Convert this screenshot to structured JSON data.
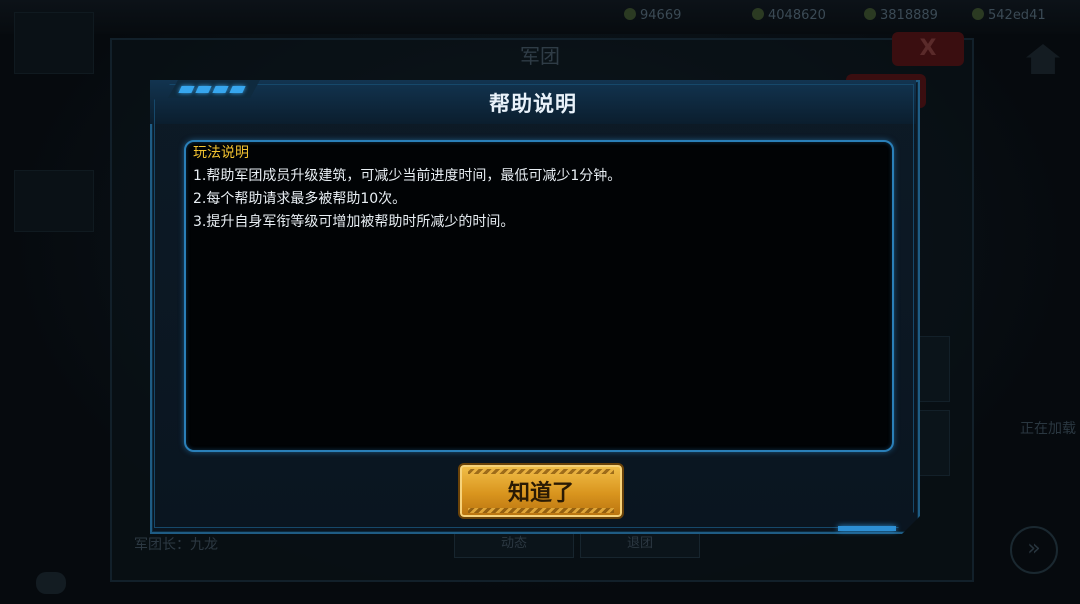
{
  "background": {
    "title": "军团",
    "resources": [
      "94669",
      "4048620",
      "3818889",
      "542ed41"
    ],
    "side_labels": [
      "军团长：九龙"
    ],
    "buttons": [
      "动态",
      "退团"
    ],
    "right_text": "正在加载"
  },
  "dialog": {
    "title": "帮助说明",
    "section_heading": "玩法说明",
    "lines": [
      "1.帮助军团成员升级建筑，可减少当前进度时间，最低可减少1分钟。",
      "2.每个帮助请求最多被帮助10次。",
      "3.提升自身军衔等级可增加被帮助时所减少的时间。"
    ],
    "confirm_label": "知道了"
  },
  "colors": {
    "accent": "#37a6ee",
    "heading": "#f2c230",
    "button_gold": "#d9951e"
  }
}
